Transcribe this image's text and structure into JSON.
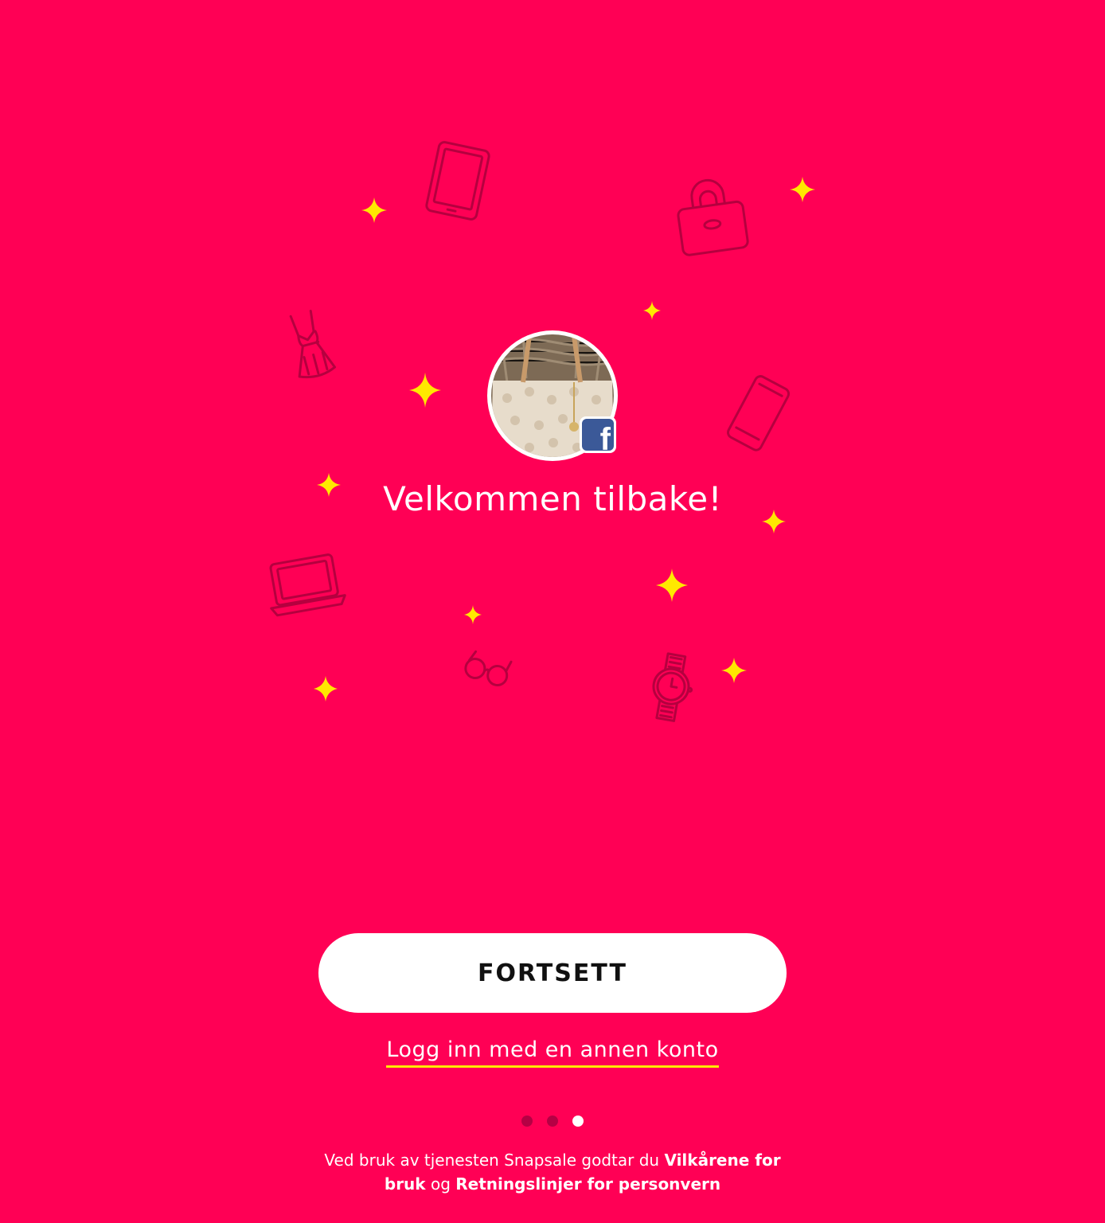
{
  "welcome": {
    "title": "Velkommen tilbake!"
  },
  "avatar": {
    "alt": "Profilbilde",
    "badge": "f"
  },
  "actions": {
    "continue_label": "FORTSETT",
    "other_account_label": "Logg inn med en annen konto"
  },
  "pager": {
    "count": 3,
    "active_index": 2
  },
  "terms": {
    "prefix": "Ved bruk av tjenesten Snapsale godtar du ",
    "terms_link": "Vilkårene for bruk",
    "conjunction": " og ",
    "privacy_link": "Retningslinjer for personvern"
  },
  "colors": {
    "background": "#ff0055",
    "sparkle": "#ffe800",
    "facebook": "#3b5998",
    "dot_inactive": "#b50044"
  },
  "decorations": [
    "tablet-icon",
    "handbag-icon",
    "dress-icon",
    "phone-icon",
    "laptop-icon",
    "glasses-icon",
    "watch-icon",
    "sparkle-icon"
  ]
}
